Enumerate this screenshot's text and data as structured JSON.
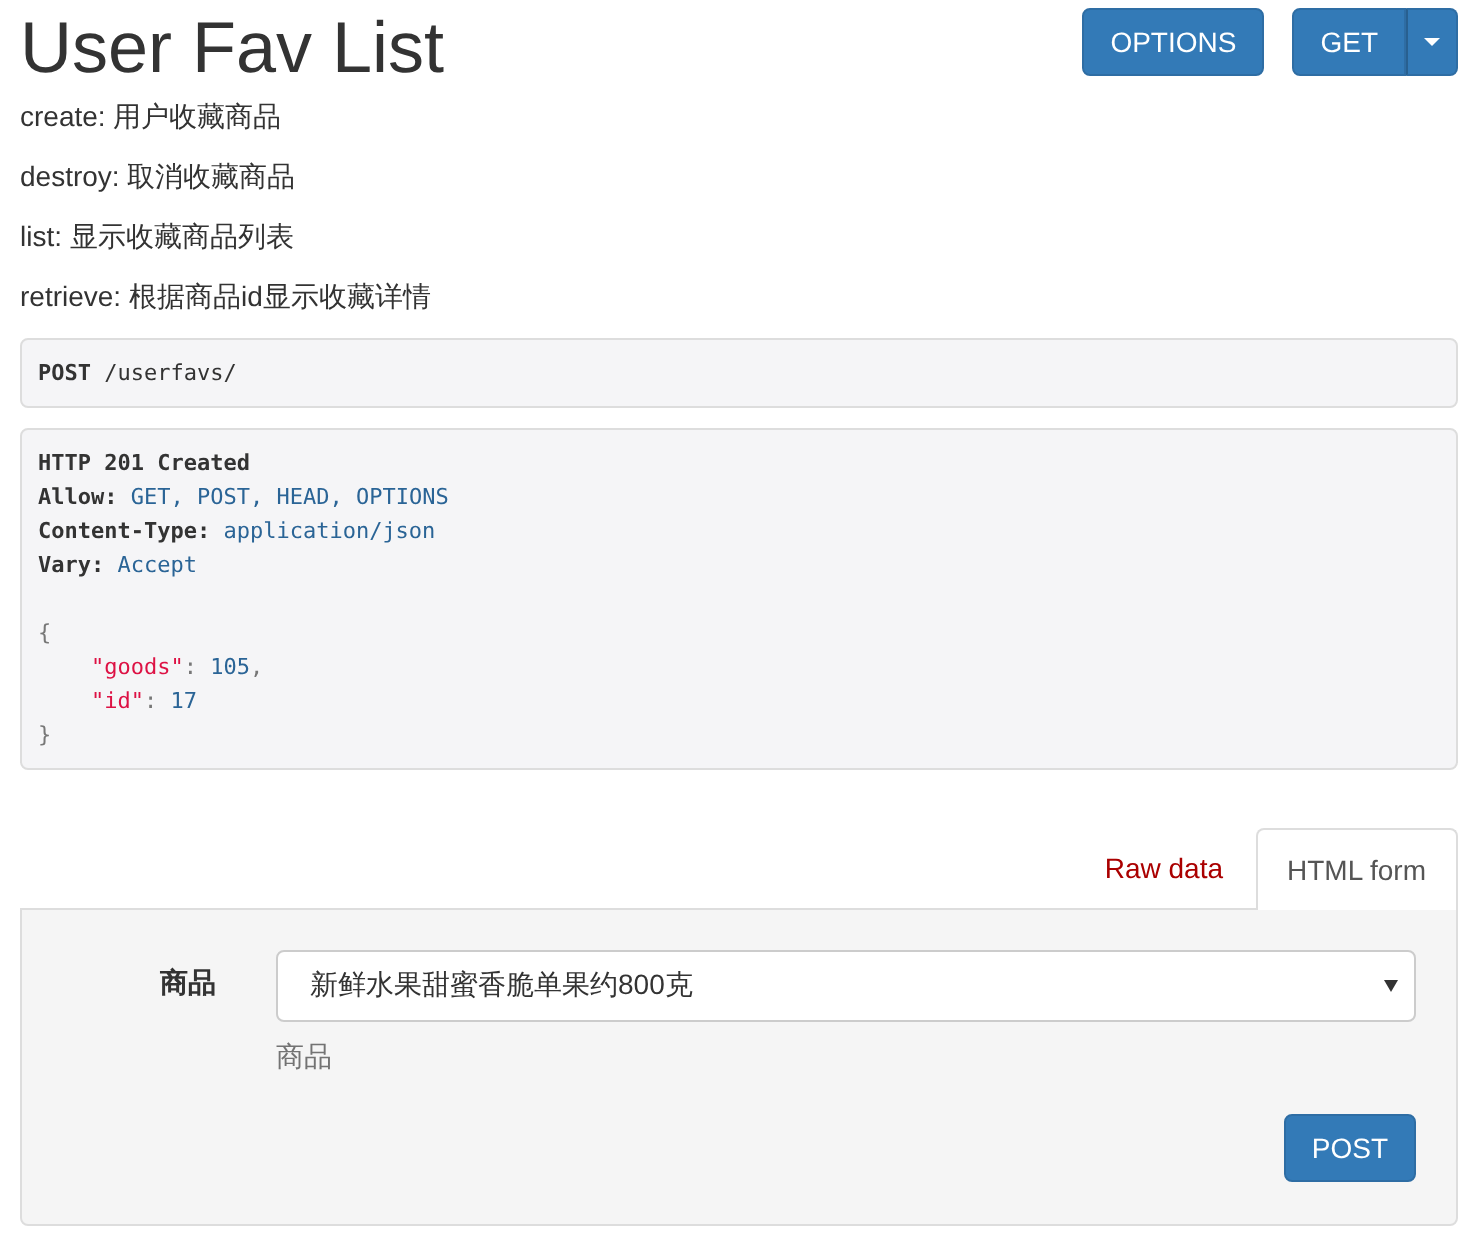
{
  "title": "User Fav List",
  "buttons": [
    {
      "label": "OPTIONS",
      "kind": "plain"
    },
    {
      "label": "GET",
      "kind": "split"
    }
  ],
  "description": [
    "create: 用户收藏商品",
    "destroy: 取消收藏商品",
    "list: 显示收藏商品列表",
    "retrieve: 根据商品id显示收藏详情"
  ],
  "request": {
    "method": "POST",
    "path": "/userfavs/"
  },
  "response": {
    "status": "HTTP 201 Created",
    "headers": [
      {
        "name": "Allow:",
        "value": "GET, POST, HEAD, OPTIONS"
      },
      {
        "name": "Content-Type:",
        "value": "application/json"
      },
      {
        "name": "Vary:",
        "value": "Accept"
      }
    ],
    "body": [
      {
        "tokens": [
          {
            "text": "{",
            "kind": "punct"
          }
        ],
        "children": [
          {
            "tokens": [
              {
                "text": "\"goods\"",
                "kind": "string"
              },
              {
                "text": ": ",
                "kind": "punct"
              },
              {
                "text": "105",
                "kind": "number"
              },
              {
                "text": ",",
                "kind": "punct"
              }
            ]
          },
          {
            "tokens": [
              {
                "text": "\"id\"",
                "kind": "string"
              },
              {
                "text": ": ",
                "kind": "punct"
              },
              {
                "text": "17",
                "kind": "number"
              }
            ]
          }
        ]
      },
      {
        "tokens": [
          {
            "text": "}",
            "kind": "punct"
          }
        ]
      }
    ]
  },
  "tabs": [
    {
      "label": "Raw data",
      "selected": false
    },
    {
      "label": "HTML form",
      "selected": true
    }
  ],
  "form": {
    "field_label": "商品",
    "select_value": "新鲜水果甜蜜香脆单果约800克",
    "help": "商品",
    "submit": "POST"
  }
}
